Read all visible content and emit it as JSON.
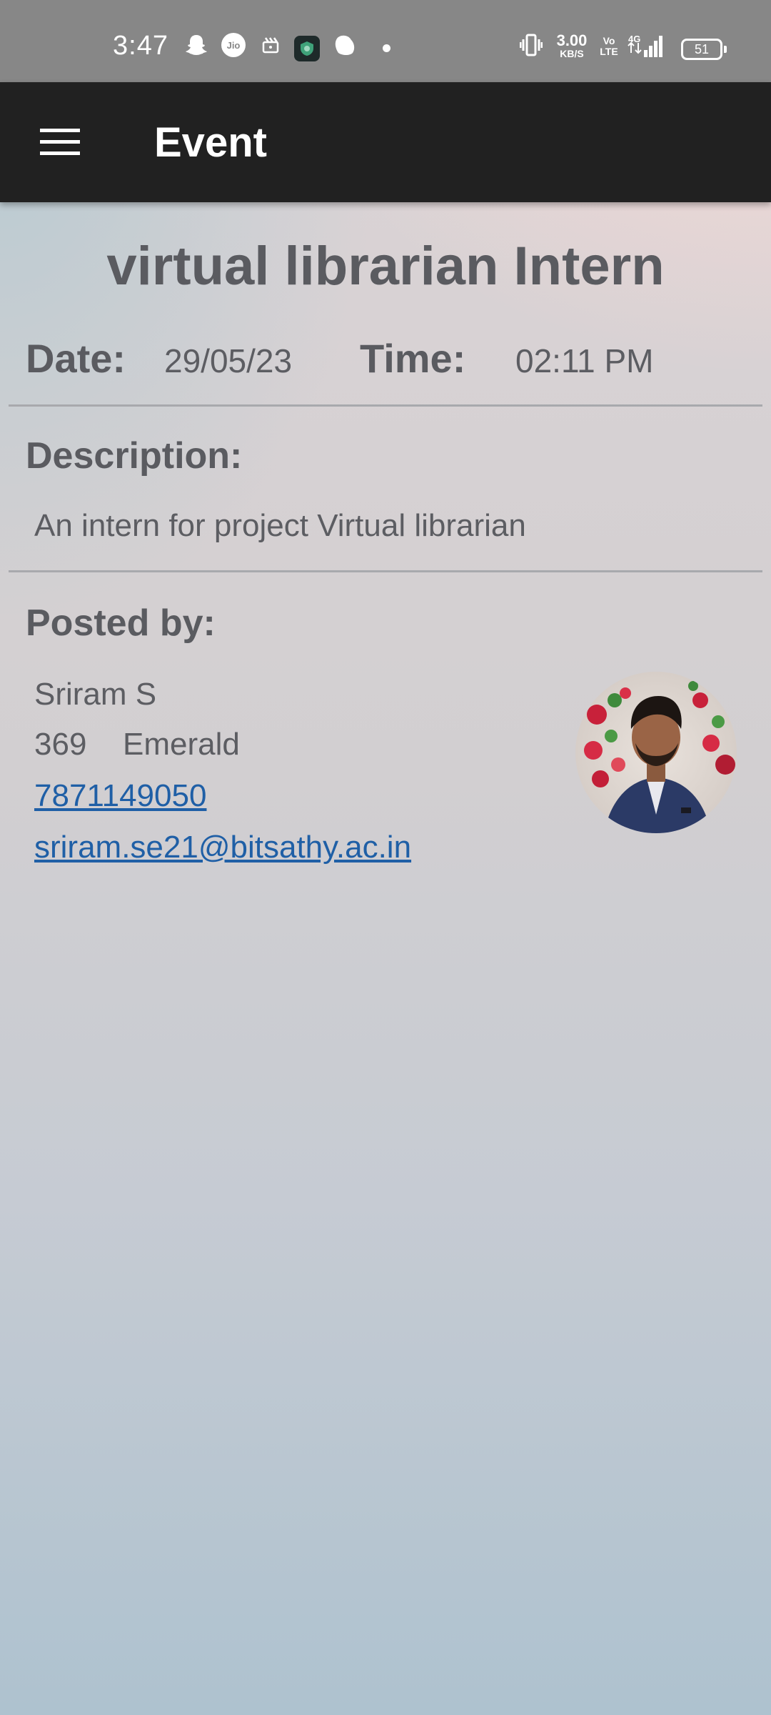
{
  "status_bar": {
    "time": "3:47",
    "jio_label": "Jio",
    "net_speed": "3.00",
    "net_unit": "KB/S",
    "volte": "Vo\nLTE",
    "network": "4G",
    "battery": "51"
  },
  "app_bar": {
    "title": "Event"
  },
  "event": {
    "title": "virtual librarian Intern",
    "date_label": "Date:",
    "date": "29/05/23",
    "time_label": "Time:",
    "time": "02:11 PM",
    "description_label": "Description:",
    "description": "An intern for project Virtual librarian"
  },
  "poster": {
    "label": "Posted by:",
    "name": "Sriram S",
    "id": "369",
    "department": "Emerald",
    "phone": "7871149050",
    "email": "sriram.se21@bitsathy.ac.in"
  },
  "colors": {
    "app_bar": "#212121",
    "status_bar": "#878787",
    "link": "#1f5fa6",
    "text": "#5a5b60"
  }
}
